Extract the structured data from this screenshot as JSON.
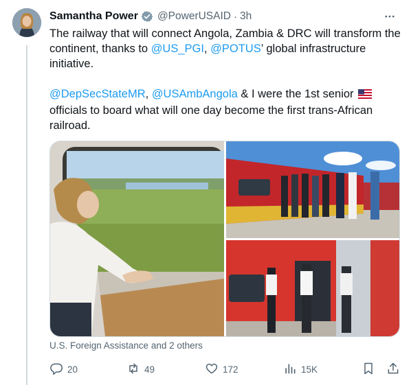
{
  "author": {
    "name": "Samantha Power",
    "handle": "@PowerUSAID",
    "separator": "·",
    "time": "3h"
  },
  "tweet": {
    "p1_a": "The railway that will connect Angola, Zambia & DRC will transform the continent, thanks to ",
    "mention_pgi": "@US_PGI",
    "p1_b": ", ",
    "mention_potus": "@POTUS",
    "p1_c": "’ global infrastructure initiative.",
    "mention_depsec": "@DepSecStateMR",
    "p2_a": ", ",
    "mention_amb": "@USAmbAngola",
    "p2_b": " & I were the 1st senior ",
    "p2_c": " officials to board what will one day become the first trans-African railroad."
  },
  "media": {
    "attribution": "U.S. Foreign Assistance and 2 others"
  },
  "actions": {
    "replies": "20",
    "reposts": "49",
    "likes": "172",
    "views": "15K"
  },
  "colors": {
    "link": "#1d9bf0",
    "text": "#0f1419",
    "muted": "#536471",
    "verified": "#829aab"
  },
  "icons": {
    "verified": "verified-badge-icon",
    "more": "more-dots-icon",
    "flag": "us-flag-icon",
    "reply": "reply-icon",
    "repost": "repost-icon",
    "like": "heart-icon",
    "views": "views-bars-icon",
    "bookmark": "bookmark-icon",
    "share": "share-icon"
  }
}
